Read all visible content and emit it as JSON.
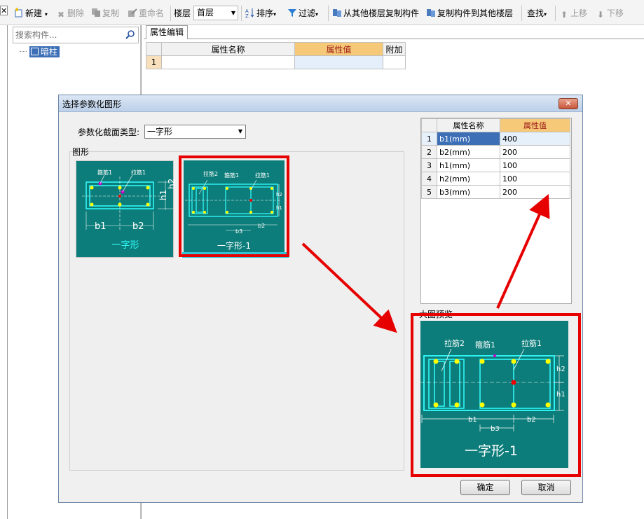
{
  "toolbar": {
    "close_glyph": "✕",
    "new_label": "新建",
    "delete_label": "删除",
    "copy_label": "复制",
    "rename_label": "重命名",
    "floor_label": "楼层",
    "floor_value": "首层",
    "sort_label": "排序",
    "filter_label": "过滤",
    "copy_from_label": "从其他楼层复制构件",
    "copy_to_label": "复制构件到其他楼层",
    "find_label": "查找",
    "move_up_label": "上移",
    "move_down_label": "下移"
  },
  "left": {
    "search_placeholder": "搜索构件...",
    "tree_item": "暗柱"
  },
  "prop_editor": {
    "tab": "属性编辑",
    "col_name": "属性名称",
    "col_value": "属性值",
    "col_extra": "附加",
    "row1": "1"
  },
  "dialog": {
    "title": "选择参数化图形",
    "close_glyph": "✕",
    "type_label": "参数化截面类型:",
    "type_value": "一字形",
    "group_label": "图形",
    "thumb1_caption": "一字形",
    "thumb2_caption": "一字形-1",
    "table": {
      "col_name": "属性名称",
      "col_value": "属性值",
      "rows": [
        {
          "n": "1",
          "name": "b1(mm)",
          "value": "400"
        },
        {
          "n": "2",
          "name": "b2(mm)",
          "value": "200"
        },
        {
          "n": "3",
          "name": "h1(mm)",
          "value": "100"
        },
        {
          "n": "4",
          "name": "h2(mm)",
          "value": "100"
        },
        {
          "n": "5",
          "name": "b3(mm)",
          "value": "200"
        }
      ]
    },
    "preview_label": "大图预览",
    "preview": {
      "caption": "一字形-1",
      "lajin2": "拉筋2",
      "gujin1": "箍筋1",
      "lajin1": "拉筋1",
      "h2": "h2",
      "h1": "h1",
      "b1": "b1",
      "b2": "b2",
      "b3": "b3"
    },
    "thumb1_labels": {
      "gujin1": "箍筋1",
      "lajin1": "拉筋1",
      "b1": "b1",
      "b2": "b2",
      "h1": "h1",
      "h2": "h2"
    },
    "thumb2_labels": {
      "lajin2": "拉筋2",
      "gujin1": "箍筋1",
      "lajin1": "拉筋1",
      "h2": "h2",
      "h1": "h1",
      "b3": "b3",
      "b2": "b2"
    },
    "ok_label": "确定",
    "cancel_label": "取消"
  },
  "colors": {
    "thumb_bg": "#0c7d7a",
    "highlight_red": "#e60000",
    "header_orange": "#f6c978"
  }
}
